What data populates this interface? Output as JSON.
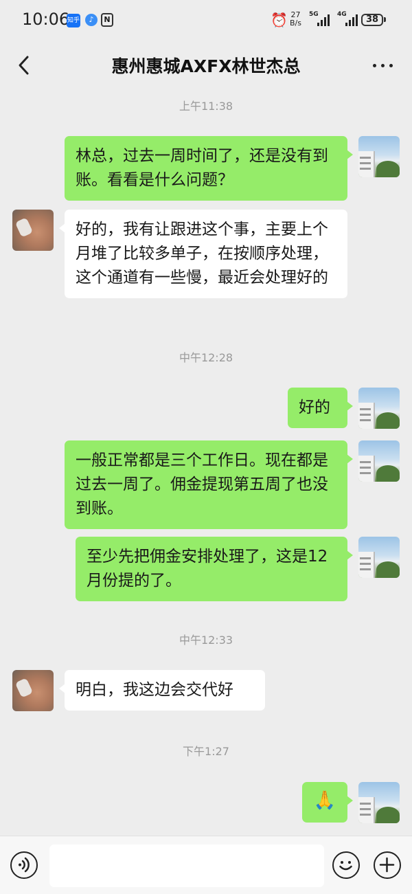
{
  "status_bar": {
    "time": "10:06",
    "zhihu_label": "知乎",
    "nfc_label": "N",
    "speed_value": "27",
    "speed_unit": "B/s",
    "net_1": "5G",
    "net_2": "4G",
    "battery": "38"
  },
  "header": {
    "title": "惠州惠城AXFX林世杰总"
  },
  "messages": [
    {
      "type": "time",
      "text": "上午11:38"
    },
    {
      "type": "msg",
      "from": "me",
      "text": "林总，过去一周时间了，还是没有到账。看看是什么问题？"
    },
    {
      "type": "msg",
      "from": "other",
      "text": "好的，我有让跟进这个事，主要上个月堆了比较多单子，在按顺序处理，这个通道有一些慢，最近会处理好的"
    },
    {
      "type": "time",
      "text": "中午12:28"
    },
    {
      "type": "msg",
      "from": "me",
      "text": "好的"
    },
    {
      "type": "msg",
      "from": "me",
      "text": "一般正常都是三个工作日。现在都是过去一周了。佣金提现第五周了也没到账。"
    },
    {
      "type": "msg",
      "from": "me",
      "text": "至少先把佣金安排处理了，这是12月份提的了。"
    },
    {
      "type": "time",
      "text": "中午12:33"
    },
    {
      "type": "msg",
      "from": "other",
      "text": "明白，我这边会交代好"
    },
    {
      "type": "time",
      "text": "下午1:27"
    },
    {
      "type": "msg",
      "from": "me",
      "text": "🙏",
      "icon": "pray-emoji-icon"
    }
  ],
  "input": {
    "placeholder": ""
  },
  "colors": {
    "background": "#ededed",
    "bubble_me": "#95ec69",
    "bubble_other": "#ffffff",
    "timestamp": "#999999"
  }
}
